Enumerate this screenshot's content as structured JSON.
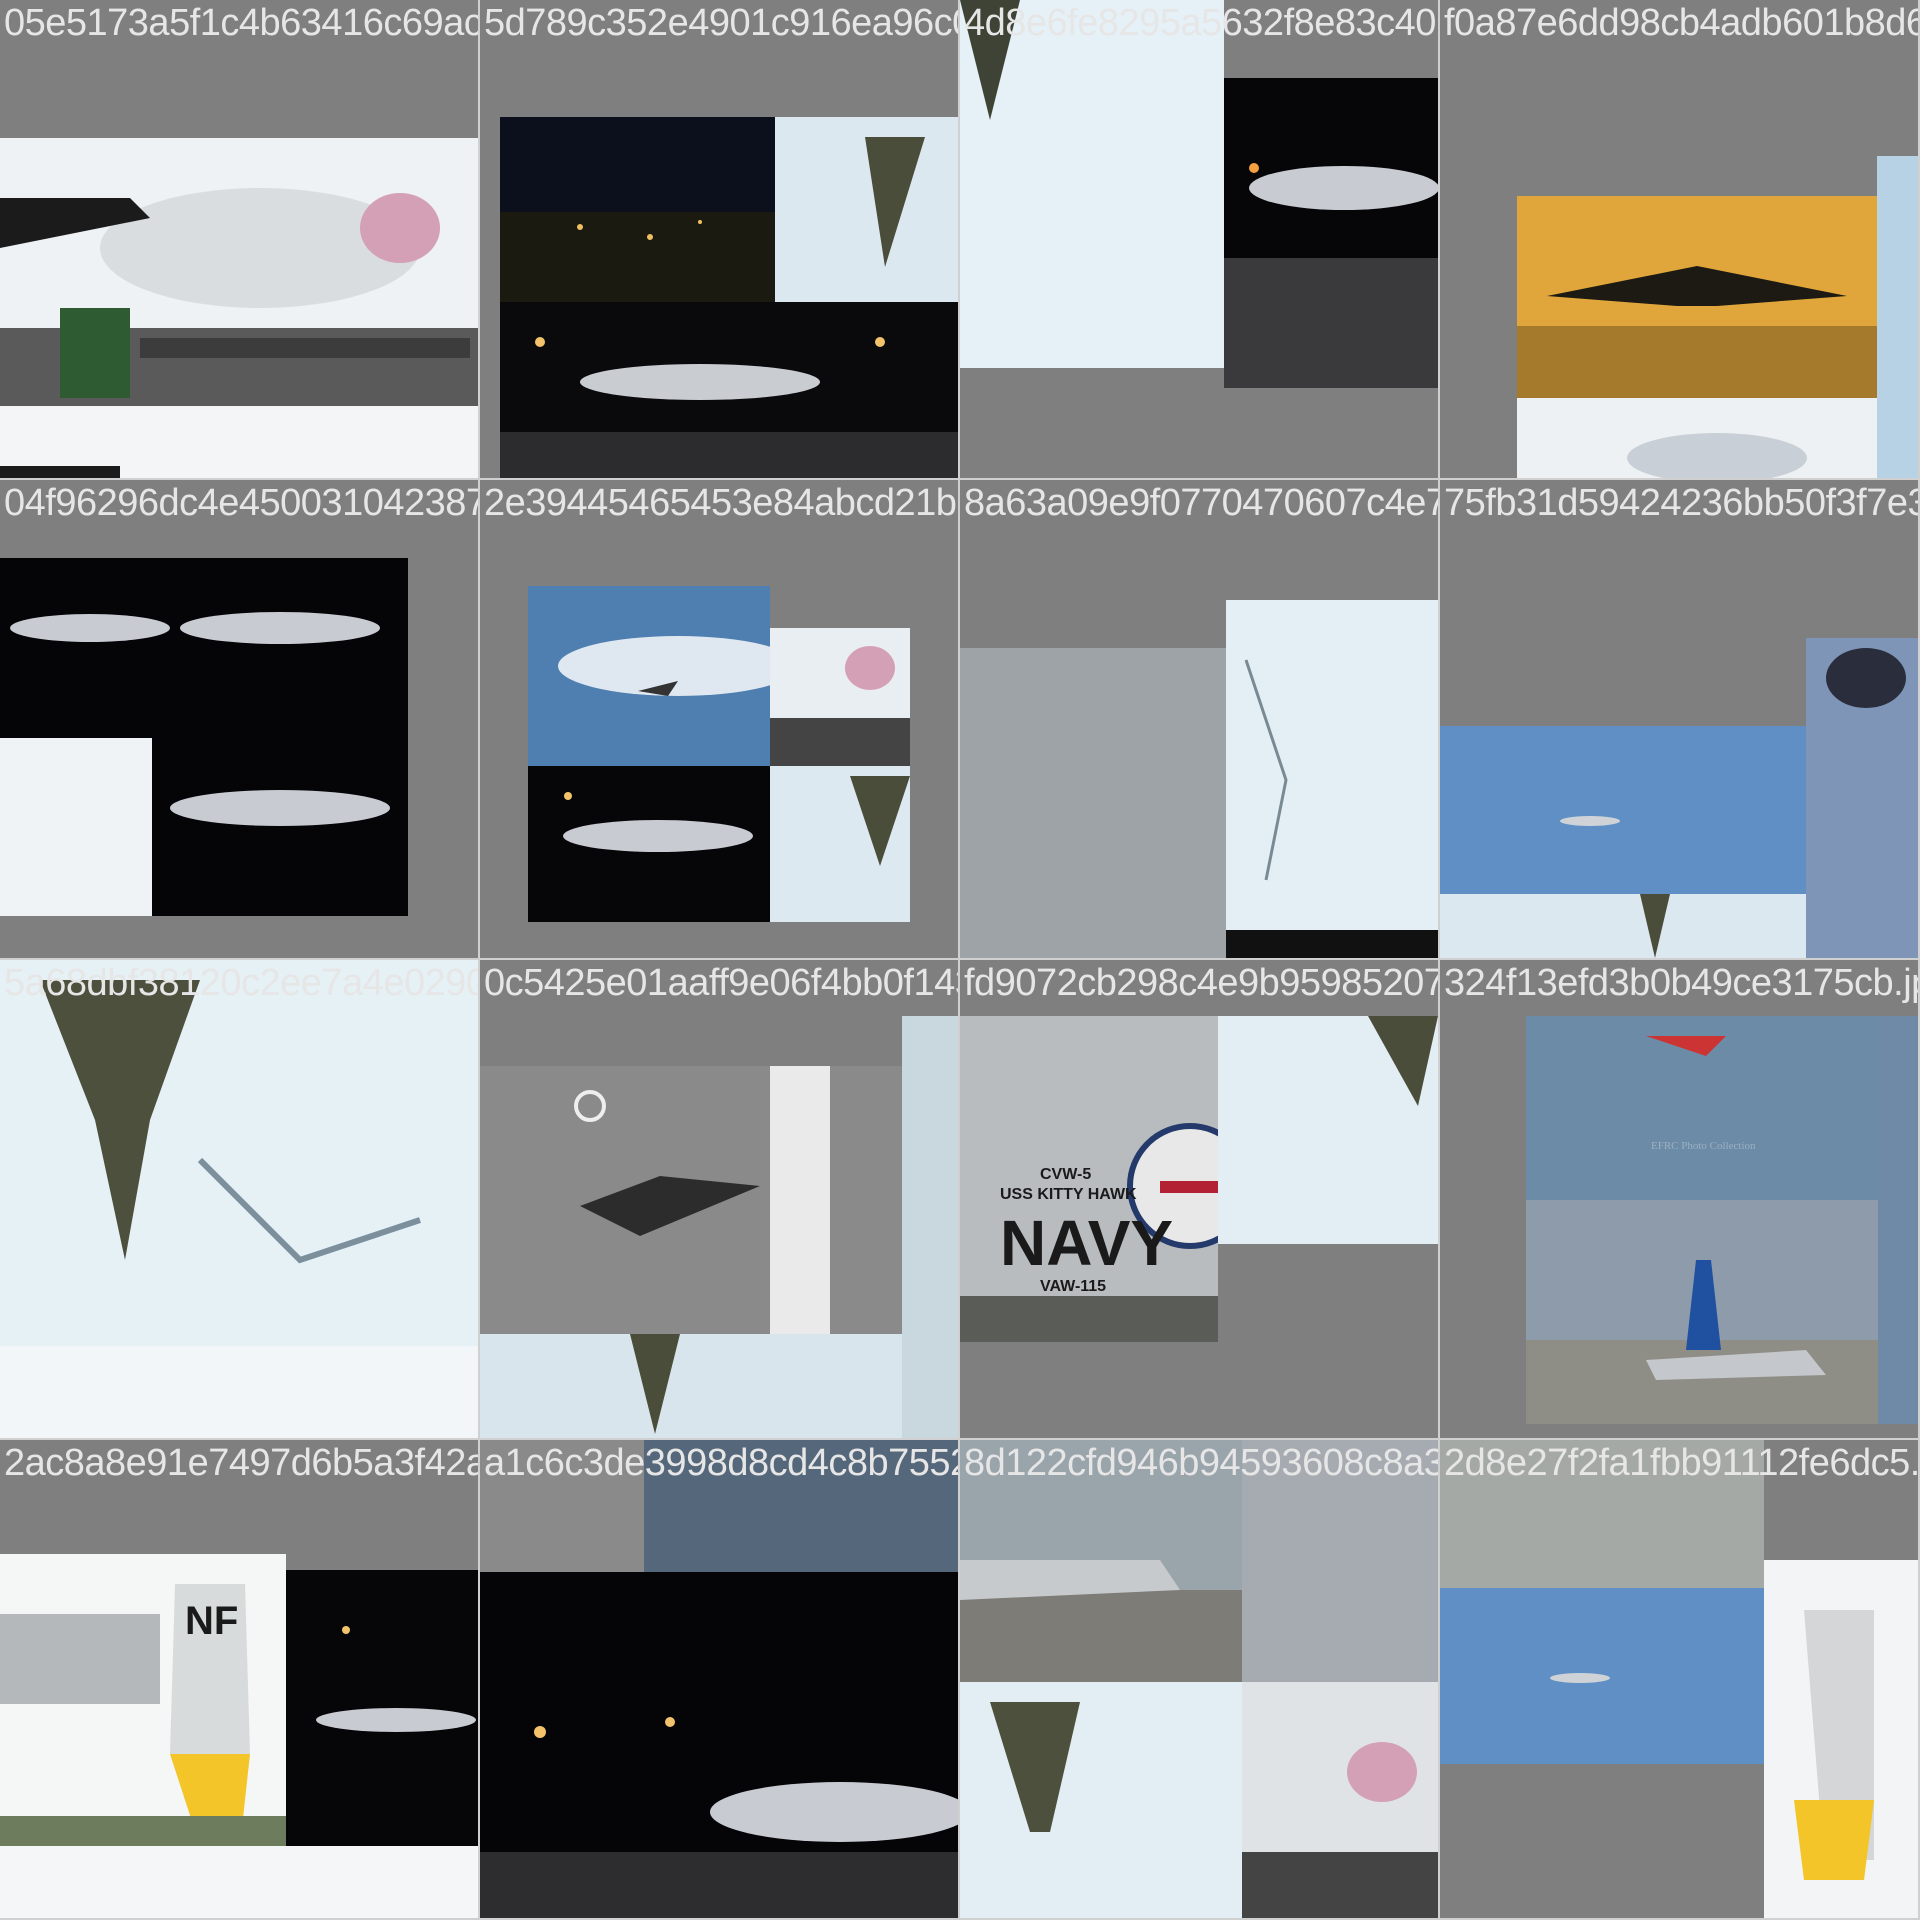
{
  "tiles": [
    {
      "filename": "05e5173a5f1c4b63416c69ac58799012.jpg"
    },
    {
      "filename": "5d789c352e4901c916ea96c04d356f0e3.jpg"
    },
    {
      "filename": "4d8e6fe8295a5632f8e83c401967e5d.jpg"
    },
    {
      "filename": "f0a87e6dd98cb4adb601b8d6.jpg"
    },
    {
      "filename": "04f96296dc4e450031042387d890f6e.jpg"
    },
    {
      "filename": "2e39445465453e84abcd21b84761008a.jpg"
    },
    {
      "filename": "8a63a09e9f0770470607c4e759f33d57.jpg"
    },
    {
      "filename": "75fb31d59424236bb50f3f7e3.jpg"
    },
    {
      "filename": "5a68dbf38120c2ee7a4e0290c5425b1.jpg"
    },
    {
      "filename": "0c5425e01aaff9e06f4bb0f14356e7a1.jpg"
    },
    {
      "filename": "fd9072cb298c4e9b959852074f3751.jpg"
    },
    {
      "filename": "324f13efd3b0b49ce3175cb.jpg"
    },
    {
      "filename": "2ac8a8e91e7497d6b5a3f42a12509848.jpg"
    },
    {
      "filename": "a1c6c3de3998d8cd4c8b7552e06.jpg"
    },
    {
      "filename": "8d122cfd946b94593608c8a3d932a57d.jpg"
    },
    {
      "filename": "2d8e27f2fa1fbb91112fe6dc5.jpg"
    }
  ],
  "overlay_text": {
    "navy_lines": [
      "CVW-5",
      "USS KITTY HAWK",
      "NAVY",
      "VAW-115"
    ],
    "tail_code": "NF",
    "watermark": "EFRC Photo Collection"
  },
  "colors": {
    "tile_gray": "#7f7f7f",
    "label_text": "#e6e6e6",
    "snow": "#e8f2f8",
    "night": "#0a0a0c",
    "sky_blue": "#4f7fb0",
    "sunset": "#e0a63c"
  }
}
